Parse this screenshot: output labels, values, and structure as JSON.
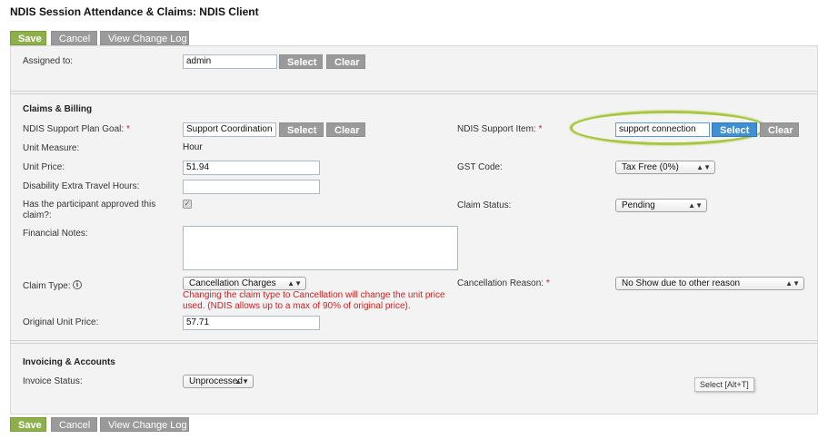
{
  "page_title": "NDIS Session Attendance & Claims: NDIS Client",
  "toolbar": {
    "save": "Save",
    "cancel": "Cancel",
    "view_change_log": "View Change Log"
  },
  "assigned": {
    "label": "Assigned to:",
    "value": "admin",
    "select": "Select",
    "clear": "Clear"
  },
  "claims": {
    "title": "Claims & Billing",
    "plan_goal_label": "NDIS Support Plan Goal:",
    "plan_goal_value": "Support Coordination",
    "select": "Select",
    "clear": "Clear",
    "required_mark": "*",
    "support_item_label": "NDIS Support Item:",
    "support_item_value": "support connection",
    "unit_measure_label": "Unit Measure:",
    "unit_measure_value": "Hour",
    "unit_price_label": "Unit Price:",
    "unit_price_value": "51.94",
    "gst_label": "GST Code:",
    "gst_value": "Tax Free (0%)",
    "travel_label": "Disability Extra Travel Hours:",
    "travel_value": "",
    "approved_label": "Has the participant approved this claim?:",
    "approved_checked": true,
    "claim_status_label": "Claim Status:",
    "claim_status_value": "Pending",
    "financial_notes_label": "Financial Notes:",
    "financial_notes_value": "",
    "claim_type_label": "Claim Type:",
    "claim_type_value": "Cancellation Charges",
    "claim_type_warning": "Changing the claim type to Cancellation will change the unit price used. (NDIS allows up to a max of 90% of original price).",
    "cancel_reason_label": "Cancellation Reason:",
    "cancel_reason_value": "No Show due to other reason",
    "original_price_label": "Original Unit Price:",
    "original_price_value": "57.71"
  },
  "invoicing": {
    "title": "Invoicing & Accounts",
    "status_label": "Invoice Status:",
    "status_value": "Unprocessed"
  },
  "tooltip": "Select [Alt+T]",
  "icons": {
    "dropdown": "updown-arrow-icon",
    "info": "info-icon",
    "check": "checkmark-icon"
  },
  "colors": {
    "save_green": "#8db04a",
    "select_blue": "#3f8fd6",
    "highlight": "#a9c63f",
    "warning_red": "#d12020"
  }
}
